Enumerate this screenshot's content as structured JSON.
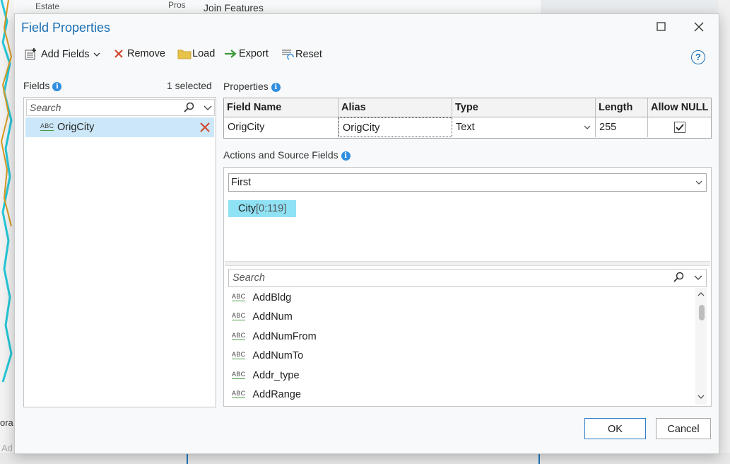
{
  "background": {
    "join_features": "Join Features",
    "map_label_estate": "Estate",
    "map_label_pros": "Pros",
    "bottom_label": "ora",
    "bottom_label2": "Ad"
  },
  "dialog": {
    "title": "Field Properties",
    "maximize_icon": "maximize-icon",
    "close_icon": "close-icon"
  },
  "toolbar": {
    "add_fields": "Add Fields",
    "remove": "Remove",
    "load": "Load",
    "export": "Export",
    "reset": "Reset",
    "help": "?"
  },
  "fields_pane": {
    "label": "Fields",
    "selected_count": "1 selected",
    "search_placeholder": "Search",
    "items": [
      {
        "type": "ABC",
        "name": "OrigCity"
      }
    ]
  },
  "properties": {
    "label": "Properties",
    "columns": [
      "Field Name",
      "Alias",
      "Type",
      "Length",
      "Allow NULL"
    ],
    "row": {
      "field_name": "OrigCity",
      "alias": "OrigCity",
      "type": "Text",
      "length": "255",
      "allow_null": true
    }
  },
  "actions": {
    "label": "Actions and Source Fields",
    "merge_rule": "First",
    "source_chip": {
      "name": "City",
      "range": "[0:119]"
    },
    "search_placeholder": "Search",
    "source_fields": [
      {
        "type": "ABC",
        "name": "AddBldg"
      },
      {
        "type": "ABC",
        "name": "AddNum"
      },
      {
        "type": "ABC",
        "name": "AddNumFrom"
      },
      {
        "type": "ABC",
        "name": "AddNumTo"
      },
      {
        "type": "ABC",
        "name": "Addr_type"
      },
      {
        "type": "ABC",
        "name": "AddRange"
      }
    ]
  },
  "footer": {
    "ok": "OK",
    "cancel": "Cancel"
  },
  "colors": {
    "accent": "#1a6fb5",
    "selection": "#cce8f8",
    "chip": "#8fe1f4",
    "remove_red": "#d0452b"
  }
}
